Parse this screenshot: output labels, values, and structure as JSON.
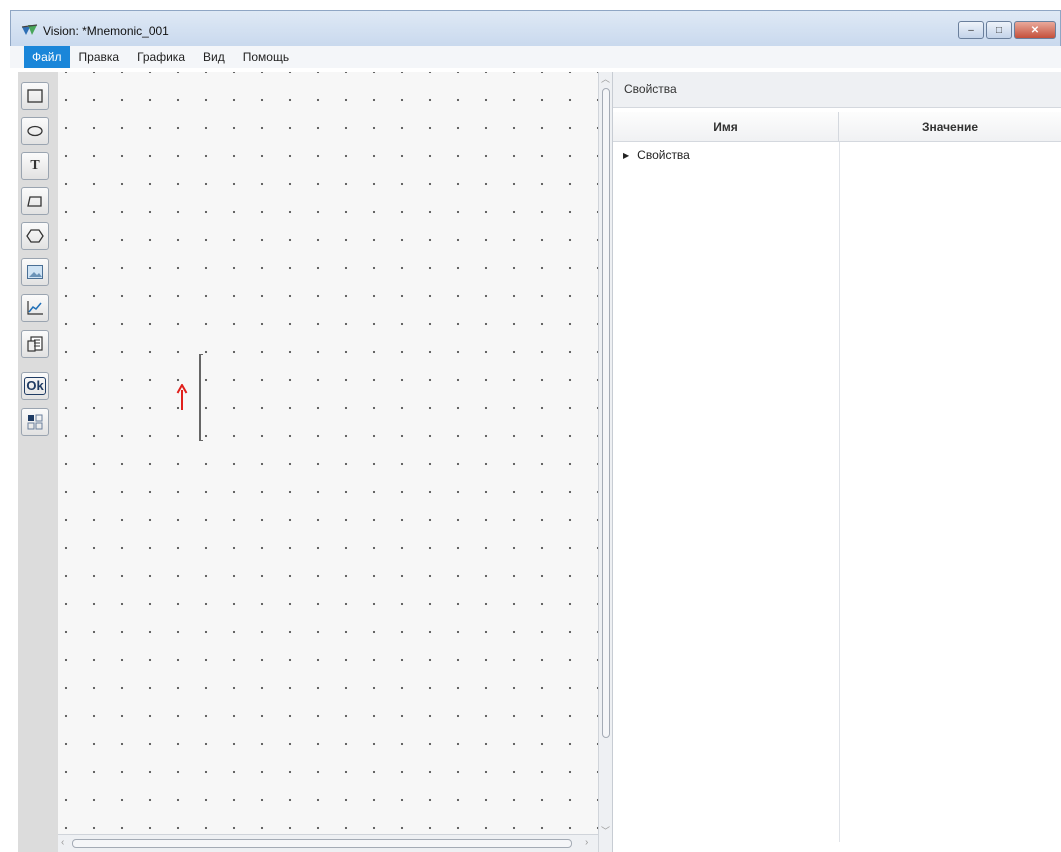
{
  "window": {
    "title": "Vision: *Mnemonic_001",
    "buttons": {
      "minimize": "–",
      "maximize": "□",
      "close": "✕"
    }
  },
  "menu": [
    {
      "label": "Файл",
      "active": true
    },
    {
      "label": "Правка"
    },
    {
      "label": "Графика"
    },
    {
      "label": "Вид"
    },
    {
      "label": "Помощь"
    }
  ],
  "toolbox": {
    "tools": [
      {
        "name": "rectangle-tool",
        "icon": "rectangle-icon"
      },
      {
        "name": "ellipse-tool",
        "icon": "ellipse-icon"
      },
      {
        "name": "text-tool",
        "icon": "text-icon",
        "glyph": "T"
      },
      {
        "name": "polyline-tool",
        "icon": "polyline-icon"
      },
      {
        "name": "polygon-tool",
        "icon": "hexagon-icon"
      },
      {
        "name": "image-tool",
        "icon": "image-icon"
      },
      {
        "name": "trend-tool",
        "icon": "trend-chart-icon"
      },
      {
        "name": "document-tool",
        "icon": "document-icon"
      },
      {
        "name": "button-tool",
        "icon": "ok-button-icon",
        "glyph": "Ok"
      },
      {
        "name": "widget-tool",
        "icon": "grid-widget-icon"
      }
    ]
  },
  "properties": {
    "header": "Свойства",
    "columns": {
      "name": "Имя",
      "value": "Значение"
    },
    "rows": [
      {
        "label": "Свойства",
        "expander": "▶"
      }
    ]
  },
  "colors": {
    "accent": "#1a86d9",
    "marker": "#e0201c"
  }
}
